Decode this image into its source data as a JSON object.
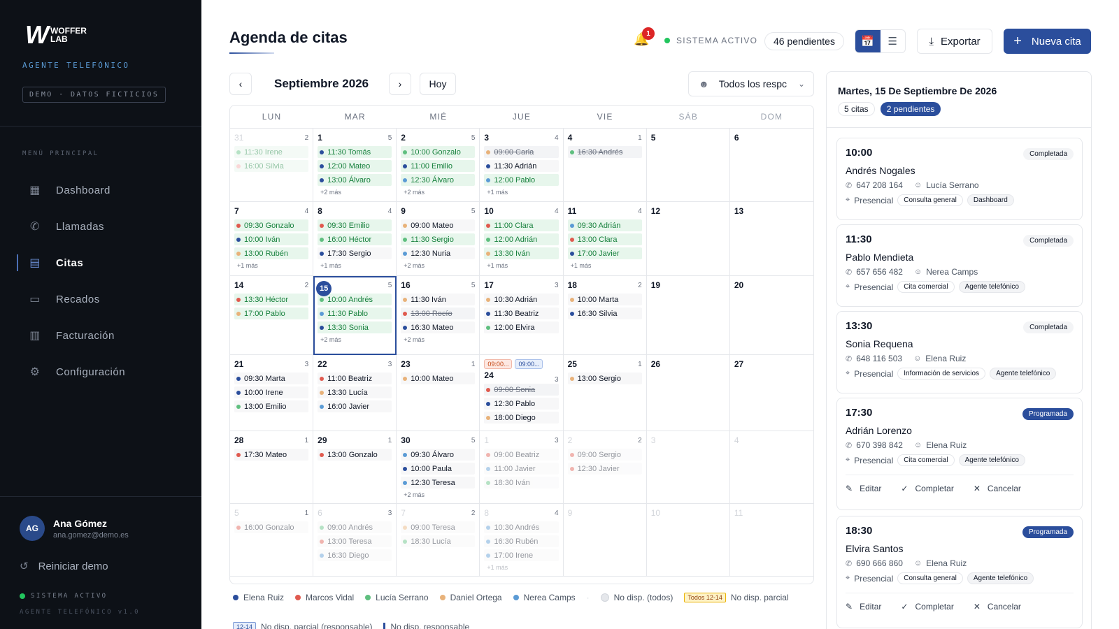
{
  "sidebar": {
    "logo_mark": "W",
    "logo_line1": "WOFFER",
    "logo_line2": "LAB",
    "subtitle": "AGENTE TELEFÓNICO",
    "demo_badge": "DEMO · DATOS FICTICIOS",
    "menu_title": "MENÚ PRINCIPAL",
    "items": [
      {
        "label": "Dashboard",
        "icon": "grid-icon"
      },
      {
        "label": "Llamadas",
        "icon": "phone-icon"
      },
      {
        "label": "Citas",
        "icon": "calendar-icon",
        "active": true
      },
      {
        "label": "Recados",
        "icon": "message-icon"
      },
      {
        "label": "Facturación",
        "icon": "invoice-icon"
      },
      {
        "label": "Configuración",
        "icon": "gear-icon"
      }
    ],
    "user": {
      "initials": "AG",
      "name": "Ana Gómez",
      "email": "ana.gomez@demo.es"
    },
    "reset_label": "Reiniciar demo",
    "status": "SISTEMA ACTIVO",
    "version": "AGENTE TELEFÓNICO v1.0"
  },
  "header": {
    "title": "Agenda de citas",
    "notifications": "1",
    "status": "SISTEMA ACTIVO",
    "pending": "46 pendientes",
    "export_label": "Exportar",
    "new_label": "Nueva cita"
  },
  "toolbar": {
    "prev": "‹",
    "next": "›",
    "month": "Septiembre 2026",
    "today": "Hoy",
    "responsible": "Todos los respc"
  },
  "calendar": {
    "weekdays": [
      "LUN",
      "MAR",
      "MIÉ",
      "JUE",
      "VIE",
      "SÁB",
      "DOM"
    ],
    "weeks": [
      [
        {
          "day": "31",
          "count": "2",
          "out": true,
          "events": [
            {
              "t": "11:30 Irene",
              "c": "#5fbf7f",
              "s": "done"
            },
            {
              "t": "16:00 Silvia",
              "c": "#f5a8a8",
              "s": "done"
            }
          ]
        },
        {
          "day": "1",
          "count": "5",
          "events": [
            {
              "t": "11:30 Tomás",
              "c": "#2b4e9c",
              "s": "done"
            },
            {
              "t": "12:00 Mateo",
              "c": "#2b4e9c",
              "s": "done"
            },
            {
              "t": "13:00 Álvaro",
              "c": "#2b4e9c",
              "s": "done"
            }
          ],
          "more": "+2 más"
        },
        {
          "day": "2",
          "count": "5",
          "events": [
            {
              "t": "10:00 Gonzalo",
              "c": "#5fbf7f",
              "s": "done"
            },
            {
              "t": "11:00 Emilio",
              "c": "#2b4e9c",
              "s": "done"
            },
            {
              "t": "12:30 Álvaro",
              "c": "#5b9bd5",
              "s": "done"
            }
          ],
          "more": "+2 más"
        },
        {
          "day": "3",
          "count": "4",
          "events": [
            {
              "t": "09:00 Carla",
              "c": "#e8b27a",
              "s": "canc"
            },
            {
              "t": "11:30 Adrián",
              "c": "#2b4e9c",
              "s": "plain"
            },
            {
              "t": "12:00 Pablo",
              "c": "#5b9bd5",
              "s": "done"
            }
          ],
          "more": "+1 más"
        },
        {
          "day": "4",
          "count": "1",
          "events": [
            {
              "t": "16:30 Andrés",
              "c": "#5fbf7f",
              "s": "canc"
            }
          ]
        },
        {
          "day": "5",
          "events": []
        },
        {
          "day": "6",
          "events": []
        }
      ],
      [
        {
          "day": "7",
          "count": "4",
          "events": [
            {
              "t": "09:30 Gonzalo",
              "c": "#e05a4f",
              "s": "done"
            },
            {
              "t": "10:00 Iván",
              "c": "#2b4e9c",
              "s": "done"
            },
            {
              "t": "13:00 Rubén",
              "c": "#e8b27a",
              "s": "done"
            }
          ],
          "more": "+1 más"
        },
        {
          "day": "8",
          "count": "4",
          "events": [
            {
              "t": "09:30 Emilio",
              "c": "#e05a4f",
              "s": "done"
            },
            {
              "t": "16:00 Héctor",
              "c": "#5fbf7f",
              "s": "done"
            },
            {
              "t": "17:30 Sergio",
              "c": "#2b4e9c",
              "s": "plain"
            }
          ],
          "more": "+1 más"
        },
        {
          "day": "9",
          "count": "5",
          "events": [
            {
              "t": "09:00 Mateo",
              "c": "#e8b27a",
              "s": "plain"
            },
            {
              "t": "11:30 Sergio",
              "c": "#5fbf7f",
              "s": "done"
            },
            {
              "t": "12:30 Nuria",
              "c": "#5b9bd5",
              "s": "plain"
            }
          ],
          "more": "+2 más"
        },
        {
          "day": "10",
          "count": "4",
          "events": [
            {
              "t": "11:00 Clara",
              "c": "#e05a4f",
              "s": "done"
            },
            {
              "t": "12:00 Adrián",
              "c": "#5fbf7f",
              "s": "done"
            },
            {
              "t": "13:30 Iván",
              "c": "#e8b27a",
              "s": "done"
            }
          ],
          "more": "+1 más"
        },
        {
          "day": "11",
          "count": "4",
          "events": [
            {
              "t": "09:30 Adrián",
              "c": "#5b9bd5",
              "s": "done"
            },
            {
              "t": "13:00 Clara",
              "c": "#e05a4f",
              "s": "done"
            },
            {
              "t": "17:00 Javier",
              "c": "#2b4e9c",
              "s": "done"
            }
          ],
          "more": "+1 más"
        },
        {
          "day": "12",
          "events": []
        },
        {
          "day": "13",
          "events": []
        }
      ],
      [
        {
          "day": "14",
          "count": "2",
          "events": [
            {
              "t": "13:30 Héctor",
              "c": "#e05a4f",
              "s": "done"
            },
            {
              "t": "17:00 Pablo",
              "c": "#e8b27a",
              "s": "done"
            }
          ]
        },
        {
          "day": "15",
          "count": "5",
          "today": true,
          "events": [
            {
              "t": "10:00 Andrés",
              "c": "#5fbf7f",
              "s": "done"
            },
            {
              "t": "11:30 Pablo",
              "c": "#5b9bd5",
              "s": "done"
            },
            {
              "t": "13:30 Sonia",
              "c": "#2b4e9c",
              "s": "done"
            }
          ],
          "more": "+2 más"
        },
        {
          "day": "16",
          "count": "5",
          "events": [
            {
              "t": "11:30 Iván",
              "c": "#e8b27a",
              "s": "plain"
            },
            {
              "t": "13:00 Rocío",
              "c": "#e05a4f",
              "s": "canc"
            },
            {
              "t": "16:30 Mateo",
              "c": "#2b4e9c",
              "s": "plain"
            }
          ],
          "more": "+2 más"
        },
        {
          "day": "17",
          "count": "3",
          "events": [
            {
              "t": "10:30 Adrián",
              "c": "#e8b27a",
              "s": "plain"
            },
            {
              "t": "11:30 Beatriz",
              "c": "#2b4e9c",
              "s": "plain"
            },
            {
              "t": "12:00 Elvira",
              "c": "#5fbf7f",
              "s": "plain"
            }
          ]
        },
        {
          "day": "18",
          "count": "2",
          "events": [
            {
              "t": "10:00 Marta",
              "c": "#e8b27a",
              "s": "plain"
            },
            {
              "t": "16:30 Silvia",
              "c": "#2b4e9c",
              "s": "plain"
            }
          ]
        },
        {
          "day": "19",
          "events": []
        },
        {
          "day": "20",
          "events": []
        }
      ],
      [
        {
          "day": "21",
          "count": "3",
          "events": [
            {
              "t": "09:30 Marta",
              "c": "#2b4e9c",
              "s": "plain"
            },
            {
              "t": "10:00 Irene",
              "c": "#2b4e9c",
              "s": "plain"
            },
            {
              "t": "13:00 Emilio",
              "c": "#5fbf7f",
              "s": "plain"
            }
          ]
        },
        {
          "day": "22",
          "count": "3",
          "events": [
            {
              "t": "11:00 Beatriz",
              "c": "#e05a4f",
              "s": "plain"
            },
            {
              "t": "13:30 Lucía",
              "c": "#e8b27a",
              "s": "plain"
            },
            {
              "t": "16:00 Javier",
              "c": "#5b9bd5",
              "s": "plain"
            }
          ]
        },
        {
          "day": "23",
          "count": "1",
          "events": [
            {
              "t": "10:00 Mateo",
              "c": "#e8b27a",
              "s": "plain"
            }
          ]
        },
        {
          "day": "24",
          "count": "3",
          "unav": [
            "09:00...",
            "09:00..."
          ],
          "events": [
            {
              "t": "09:00 Sonia",
              "c": "#e05a4f",
              "s": "canc"
            },
            {
              "t": "12:30 Pablo",
              "c": "#2b4e9c",
              "s": "plain"
            },
            {
              "t": "18:00 Diego",
              "c": "#e8b27a",
              "s": "plain"
            }
          ]
        },
        {
          "day": "25",
          "count": "1",
          "events": [
            {
              "t": "13:00 Sergio",
              "c": "#e8b27a",
              "s": "plain"
            }
          ]
        },
        {
          "day": "26",
          "events": []
        },
        {
          "day": "27",
          "events": []
        }
      ],
      [
        {
          "day": "28",
          "count": "1",
          "events": [
            {
              "t": "17:30 Mateo",
              "c": "#e05a4f",
              "s": "plain"
            }
          ]
        },
        {
          "day": "29",
          "count": "1",
          "events": [
            {
              "t": "13:00 Gonzalo",
              "c": "#e05a4f",
              "s": "plain"
            }
          ]
        },
        {
          "day": "30",
          "count": "5",
          "events": [
            {
              "t": "09:30 Álvaro",
              "c": "#5b9bd5",
              "s": "plain"
            },
            {
              "t": "10:00 Paula",
              "c": "#2b4e9c",
              "s": "plain"
            },
            {
              "t": "12:30 Teresa",
              "c": "#5b9bd5",
              "s": "plain"
            }
          ],
          "more": "+2 más"
        },
        {
          "day": "1",
          "count": "3",
          "out": true,
          "events": [
            {
              "t": "09:00 Beatriz",
              "c": "#e05a4f",
              "s": "plain"
            },
            {
              "t": "11:00 Javier",
              "c": "#5b9bd5",
              "s": "plain"
            },
            {
              "t": "18:30 Iván",
              "c": "#5fbf7f",
              "s": "plain"
            }
          ]
        },
        {
          "day": "2",
          "count": "2",
          "out": true,
          "events": [
            {
              "t": "09:00 Sergio",
              "c": "#e05a4f",
              "s": "plain"
            },
            {
              "t": "12:30 Javier",
              "c": "#e05a4f",
              "s": "plain"
            }
          ]
        },
        {
          "day": "3",
          "out": true,
          "events": []
        },
        {
          "day": "4",
          "out": true,
          "events": []
        }
      ],
      [
        {
          "day": "5",
          "count": "1",
          "out": true,
          "events": [
            {
              "t": "16:00 Gonzalo",
              "c": "#e05a4f",
              "s": "plain"
            }
          ]
        },
        {
          "day": "6",
          "count": "3",
          "out": true,
          "events": [
            {
              "t": "09:00 Andrés",
              "c": "#5fbf7f",
              "s": "plain"
            },
            {
              "t": "13:00 Teresa",
              "c": "#e05a4f",
              "s": "plain"
            },
            {
              "t": "16:30 Diego",
              "c": "#5b9bd5",
              "s": "plain"
            }
          ]
        },
        {
          "day": "7",
          "count": "2",
          "out": true,
          "events": [
            {
              "t": "09:00 Teresa",
              "c": "#e8b27a",
              "s": "plain"
            },
            {
              "t": "18:30 Lucía",
              "c": "#5fbf7f",
              "s": "plain"
            }
          ]
        },
        {
          "day": "8",
          "count": "4",
          "out": true,
          "events": [
            {
              "t": "10:30 Andrés",
              "c": "#5b9bd5",
              "s": "plain"
            },
            {
              "t": "16:30 Rubén",
              "c": "#5b9bd5",
              "s": "plain"
            },
            {
              "t": "17:00 Irene",
              "c": "#5b9bd5",
              "s": "plain"
            }
          ],
          "more": "+1 más"
        },
        {
          "day": "9",
          "out": true,
          "events": []
        },
        {
          "day": "10",
          "out": true,
          "events": []
        },
        {
          "day": "11",
          "out": true,
          "events": []
        }
      ]
    ]
  },
  "legend": {
    "people": [
      {
        "name": "Elena Ruiz",
        "color": "#2b4e9c"
      },
      {
        "name": "Marcos Vidal",
        "color": "#e05a4f"
      },
      {
        "name": "Lucía Serrano",
        "color": "#5fbf7f"
      },
      {
        "name": "Daniel Ortega",
        "color": "#e8b27a"
      },
      {
        "name": "Nerea Camps",
        "color": "#5b9bd5"
      }
    ],
    "no_disp_all": "No disp. (todos)",
    "tag_all": "Todos 12-14",
    "no_disp_partial": "No disp. parcial",
    "tag_resp": "12-14",
    "no_disp_partial_resp": "No disp. parcial (responsable)",
    "no_disp_resp": "No disp. responsable"
  },
  "panel": {
    "date": "Martes, 15 De Septiembre De 2026",
    "citas": "5 citas",
    "pendientes": "2 pendientes",
    "cards": [
      {
        "time": "10:00",
        "status": "Completada",
        "kind": "done",
        "name": "Andrés Nogales",
        "phone": "647 208 164",
        "staff": "Lucía Serrano",
        "mode": "Presencial",
        "tag1": "Consulta general",
        "tag2": "Dashboard"
      },
      {
        "time": "11:30",
        "status": "Completada",
        "kind": "done",
        "name": "Pablo Mendieta",
        "phone": "657 656 482",
        "staff": "Nerea Camps",
        "mode": "Presencial",
        "tag1": "Cita comercial",
        "tag2": "Agente telefónico"
      },
      {
        "time": "13:30",
        "status": "Completada",
        "kind": "done",
        "name": "Sonia Requena",
        "phone": "648 116 503",
        "staff": "Elena Ruiz",
        "mode": "Presencial",
        "tag1": "Información de servicios",
        "tag2": "Agente telefónico"
      },
      {
        "time": "17:30",
        "status": "Programada",
        "kind": "prog",
        "name": "Adrián Lorenzo",
        "phone": "670 398 842",
        "staff": "Elena Ruiz",
        "mode": "Presencial",
        "tag1": "Cita comercial",
        "tag2": "Agente telefónico"
      },
      {
        "time": "18:30",
        "status": "Programada",
        "kind": "prog",
        "name": "Elvira Santos",
        "phone": "690 666 860",
        "staff": "Elena Ruiz",
        "mode": "Presencial",
        "tag1": "Consulta general",
        "tag2": "Agente telefónico"
      }
    ],
    "actions": {
      "edit": "Editar",
      "complete": "Completar",
      "cancel": "Cancelar"
    }
  }
}
